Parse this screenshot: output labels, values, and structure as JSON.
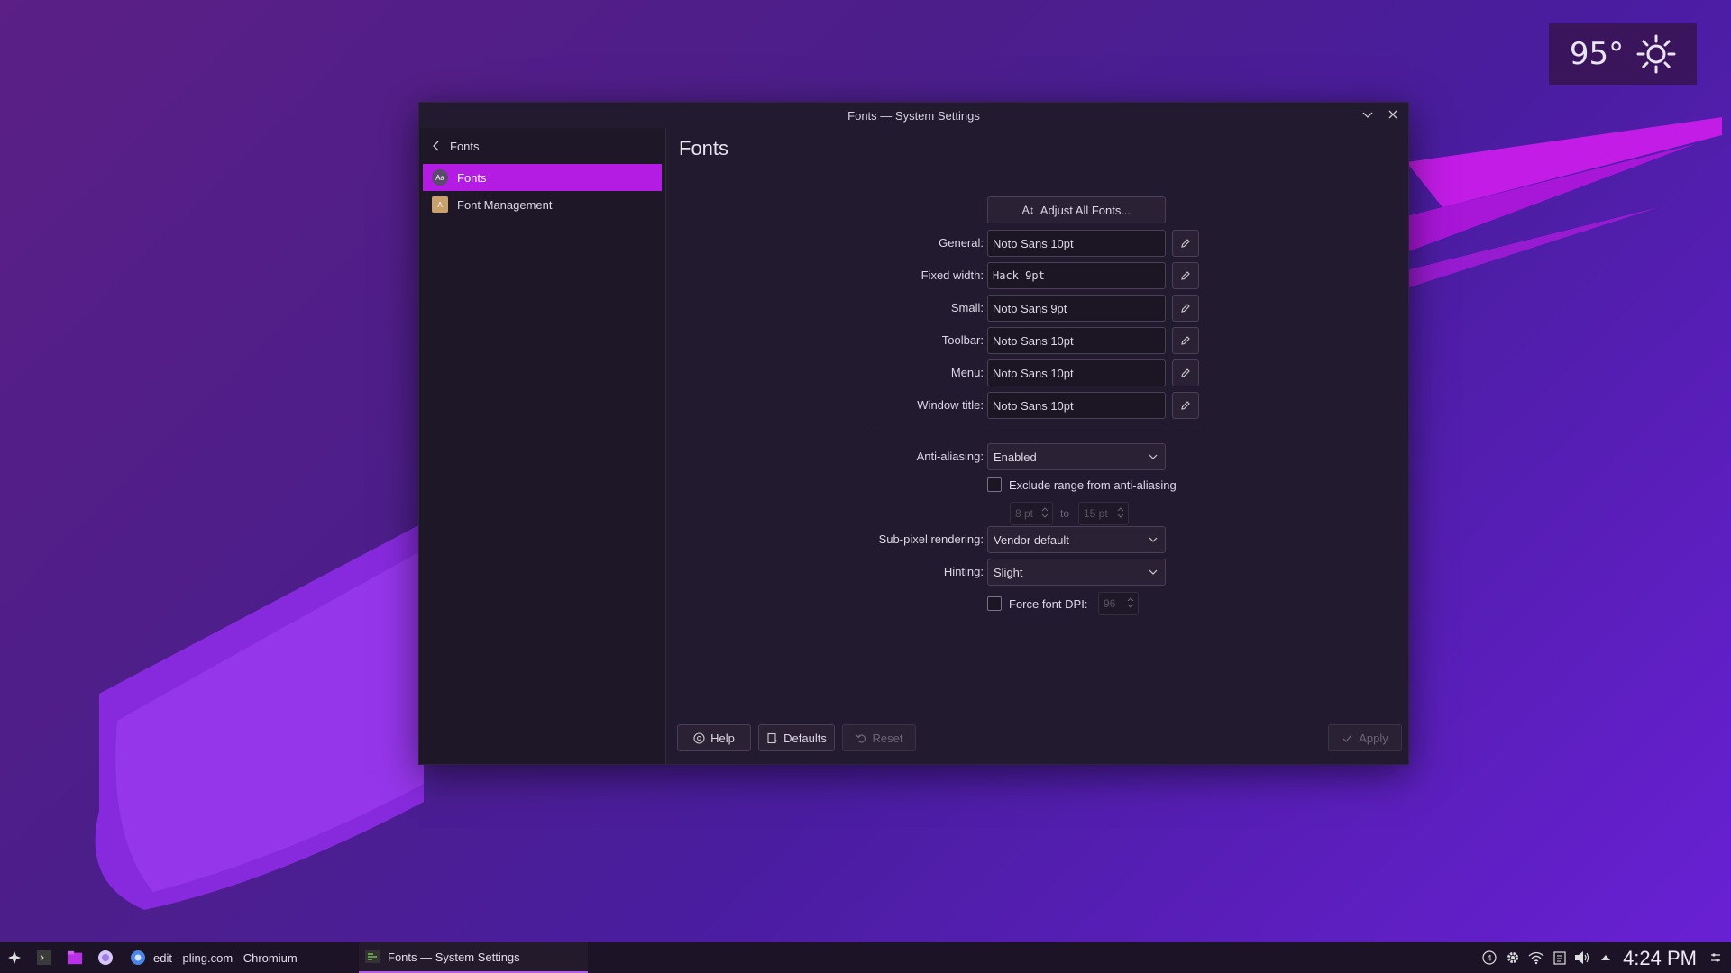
{
  "window": {
    "title": "Fonts — System Settings"
  },
  "weather": {
    "temperature": "95°",
    "icon": "sun-icon"
  },
  "sidebar": {
    "header": "Fonts",
    "items": [
      {
        "label": "Fonts",
        "icon": "font-icon",
        "active": true
      },
      {
        "label": "Font Management",
        "icon": "font-management-icon",
        "active": false
      }
    ]
  },
  "main": {
    "title": "Fonts",
    "adjust_all": "Adjust All Fonts...",
    "fonts": [
      {
        "label": "General:",
        "value": "Noto Sans 10pt"
      },
      {
        "label": "Fixed width:",
        "value": "Hack 9pt"
      },
      {
        "label": "Small:",
        "value": "Noto Sans 9pt"
      },
      {
        "label": "Toolbar:",
        "value": "Noto Sans 10pt"
      },
      {
        "label": "Menu:",
        "value": "Noto Sans 10pt"
      },
      {
        "label": "Window title:",
        "value": "Noto Sans 10pt"
      }
    ],
    "antialiasing": {
      "label": "Anti-aliasing:",
      "value": "Enabled"
    },
    "exclude_range": {
      "label": "Exclude range from anti-aliasing",
      "from": "8 pt",
      "to_label": "to",
      "to": "15 pt"
    },
    "subpixel": {
      "label": "Sub-pixel rendering:",
      "value": "Vendor default"
    },
    "hinting": {
      "label": "Hinting:",
      "value": "Slight"
    },
    "force_dpi": {
      "label": "Force font DPI:",
      "value": "96"
    }
  },
  "footer": {
    "help": "Help",
    "defaults": "Defaults",
    "reset": "Reset",
    "apply": "Apply"
  },
  "taskbar": {
    "tasks": [
      {
        "label": "edit - pling.com - Chromium",
        "icon": "chromium-icon"
      },
      {
        "label": "Fonts  — System Settings",
        "icon": "settings-icon",
        "active": true
      }
    ],
    "clock": "4:24 PM"
  },
  "colors": {
    "accent": "#b41be3",
    "window_bg": "#221a2e",
    "sidebar_bg": "#1e1728"
  }
}
